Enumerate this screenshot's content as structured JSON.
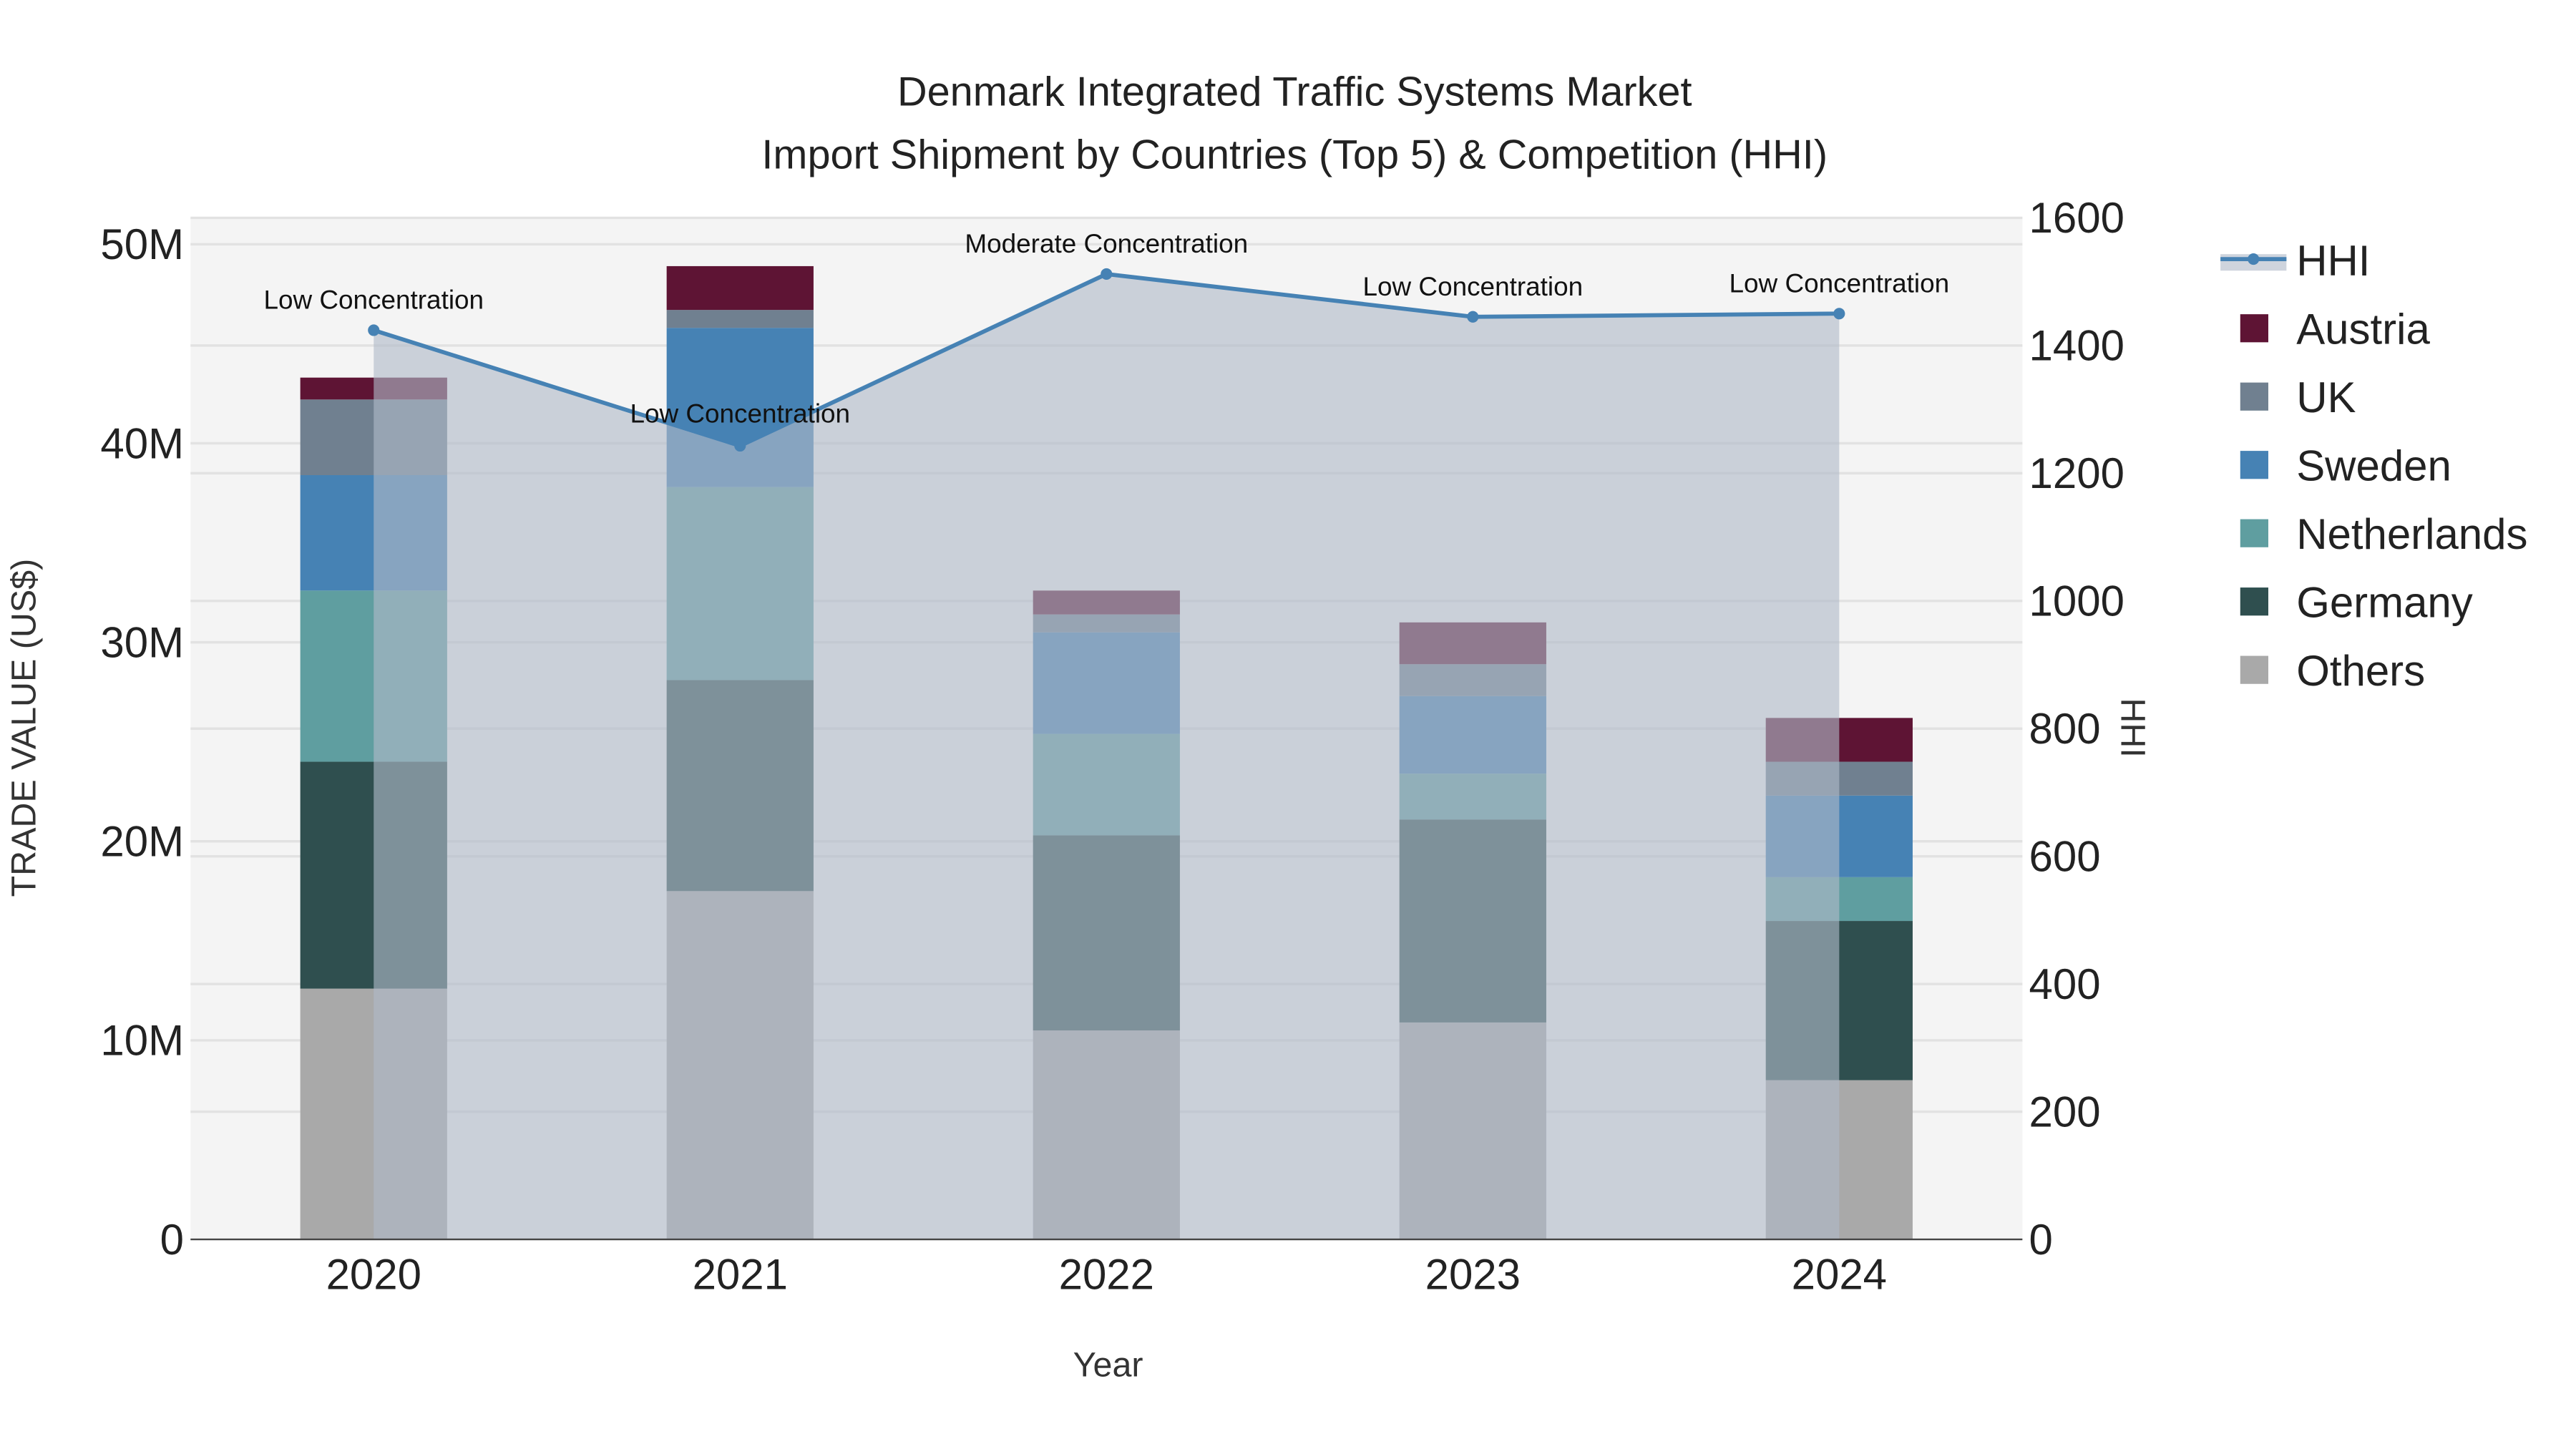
{
  "chart_data": {
    "type": "bar",
    "title": "Denmark Integrated Traffic Systems Market",
    "subtitle": "Import Shipment by Countries (Top 5) & Competition (HHI)",
    "xlabel": "Year",
    "ylabel": "TRADE VALUE (US$)",
    "y2label": "HHI",
    "categories": [
      "2020",
      "2021",
      "2022",
      "2023",
      "2024"
    ],
    "ylim": [
      0,
      51500000
    ],
    "y_ticks": [
      0,
      10000000,
      20000000,
      30000000,
      40000000,
      50000000
    ],
    "y_tick_labels": [
      "0",
      "10M",
      "20M",
      "30M",
      "40M",
      "50M"
    ],
    "y2lim": [
      0,
      1600
    ],
    "y2_ticks": [
      0,
      200,
      400,
      600,
      800,
      1000,
      1200,
      1400,
      1600
    ],
    "y2_tick_labels": [
      "0",
      "200",
      "400",
      "600",
      "800",
      "1000",
      "1200",
      "1400",
      "1600"
    ],
    "stacked": true,
    "series": [
      {
        "name": "Others",
        "color": "#a9a9a9",
        "values": [
          12600000,
          17500000,
          10500000,
          10900000,
          8000000
        ]
      },
      {
        "name": "Germany",
        "color": "#2f4f4f",
        "values": [
          11400000,
          10600000,
          9800000,
          10200000,
          8000000
        ]
      },
      {
        "name": "Netherlands",
        "color": "#5f9ea0",
        "values": [
          8600000,
          9700000,
          5100000,
          2300000,
          2200000
        ]
      },
      {
        "name": "Sweden",
        "color": "#4682b4",
        "values": [
          5800000,
          8000000,
          5100000,
          3900000,
          4100000
        ]
      },
      {
        "name": "UK",
        "color": "#708090",
        "values": [
          3800000,
          900000,
          900000,
          1600000,
          1700000
        ]
      },
      {
        "name": "Austria",
        "color": "#5e1434",
        "values": [
          1100000,
          2200000,
          1200000,
          2100000,
          2200000
        ]
      }
    ],
    "line_series": {
      "name": "HHI",
      "color": "#4682b4",
      "axis": "right",
      "values": [
        1424,
        1243,
        1512,
        1445,
        1450
      ],
      "annotations": [
        "Low Concentration",
        "Low Concentration",
        "Moderate Concentration",
        "Low Concentration",
        "Low Concentration"
      ]
    },
    "legend": {
      "position": "right",
      "items": [
        "HHI",
        "Austria",
        "UK",
        "Sweden",
        "Netherlands",
        "Germany",
        "Others"
      ]
    },
    "grid": true
  }
}
